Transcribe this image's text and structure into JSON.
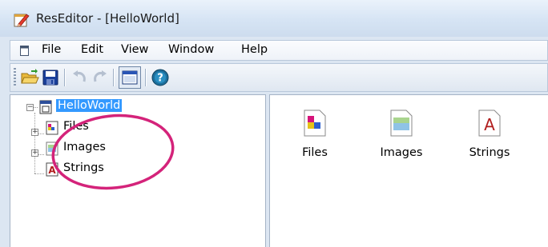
{
  "window": {
    "title": "ResEditor - [HelloWorld]",
    "app_icon": "pencil-notepad-icon"
  },
  "menu": {
    "doc_icon": "document-icon",
    "items": [
      "File",
      "Edit",
      "View",
      "Window",
      "Help"
    ]
  },
  "toolbar": {
    "buttons": [
      "open-folder-icon",
      "save-disk-icon",
      "undo-icon",
      "redo-icon",
      "window-icon",
      "help-icon"
    ],
    "window_button_pressed": true
  },
  "tree": {
    "root": {
      "label": "HelloWorld",
      "selected": true,
      "expanded": true
    },
    "children": [
      {
        "label": "Files",
        "icon": "files-icon",
        "expandable": true
      },
      {
        "label": "Images",
        "icon": "images-icon",
        "expandable": true
      },
      {
        "label": "Strings",
        "icon": "strings-icon",
        "expandable": false
      }
    ]
  },
  "list": {
    "items": [
      {
        "label": "Files",
        "icon": "files-icon"
      },
      {
        "label": "Images",
        "icon": "images-icon"
      },
      {
        "label": "Strings",
        "icon": "strings-icon"
      }
    ]
  },
  "colors": {
    "selection": "#3399ff",
    "annotation": "#d4237a"
  }
}
